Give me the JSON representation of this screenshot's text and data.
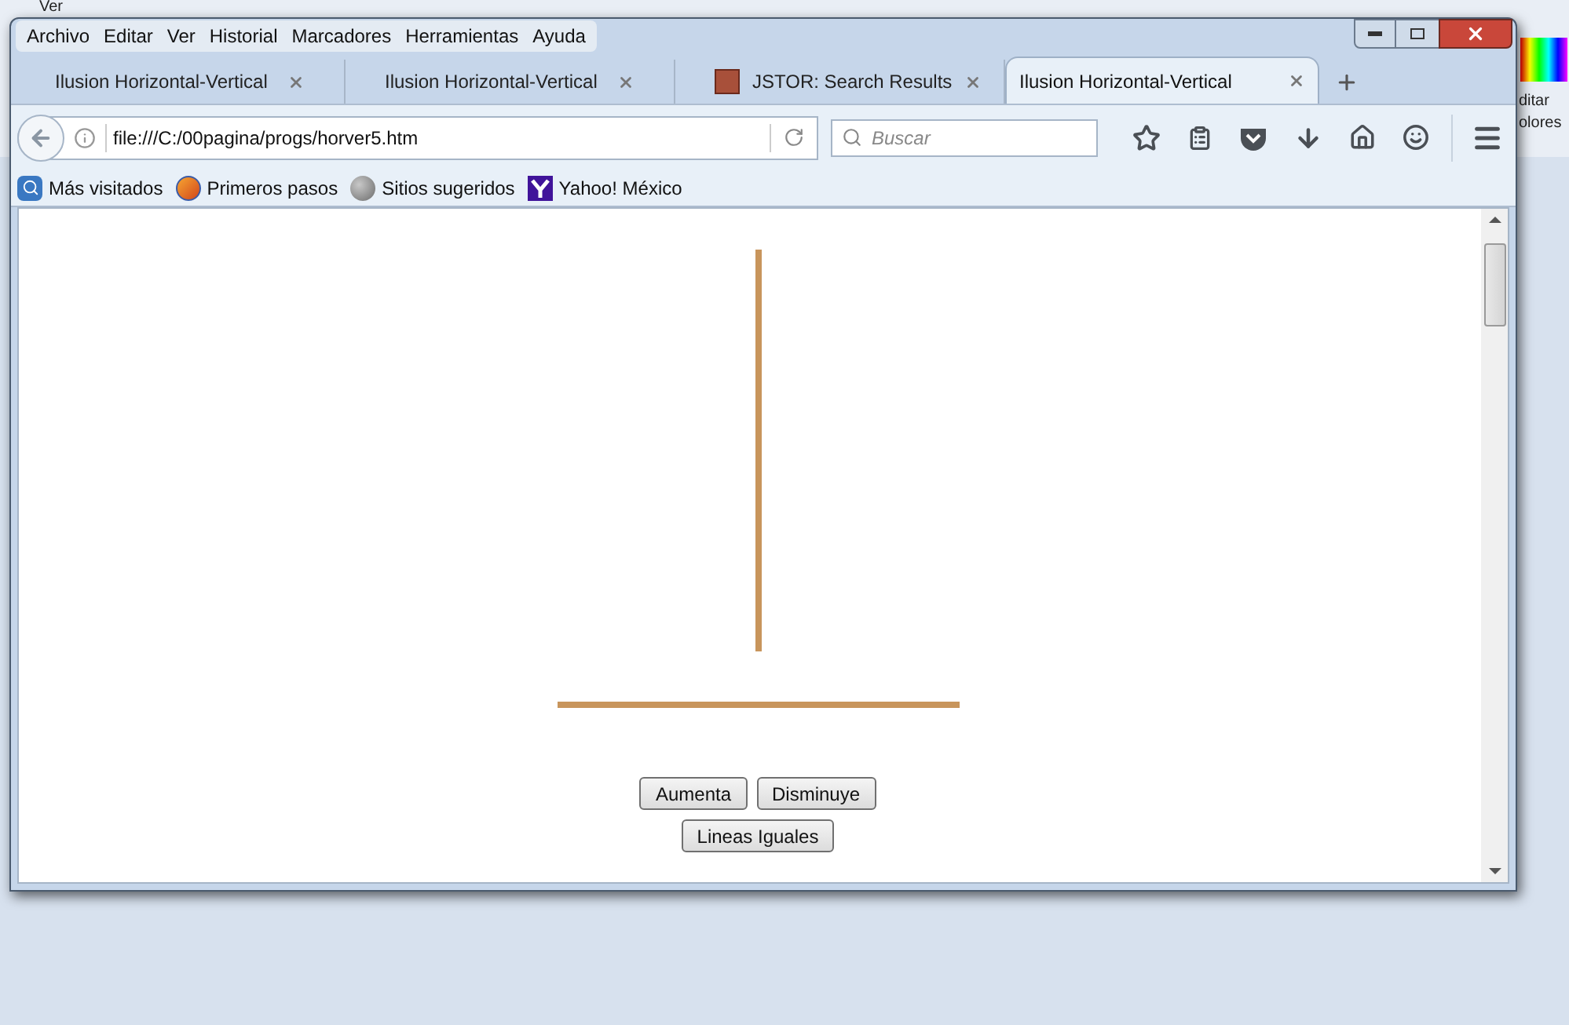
{
  "background_app": {
    "menu_label": "Ver",
    "side_labels": [
      "ditar",
      "olores"
    ]
  },
  "menubar": [
    "Archivo",
    "Editar",
    "Ver",
    "Historial",
    "Marcadores",
    "Herramientas",
    "Ayuda"
  ],
  "tabs": [
    {
      "title": "Ilusion Horizontal-Vertical",
      "selected": false,
      "kind": "plain"
    },
    {
      "title": "Ilusion Horizontal-Vertical",
      "selected": false,
      "kind": "plain"
    },
    {
      "title": "JSTOR: Search Results",
      "selected": false,
      "kind": "jstor"
    },
    {
      "title": "Ilusion Horizontal-Vertical",
      "selected": true,
      "kind": "plain"
    }
  ],
  "address_bar": {
    "value": "file:///C:/00pagina/progs/horver5.htm"
  },
  "search": {
    "placeholder": "Buscar"
  },
  "bookmarks": [
    {
      "label": "Más visitados",
      "kind": "magnifier"
    },
    {
      "label": "Primeros pasos",
      "kind": "firefox"
    },
    {
      "label": "Sitios sugeridos",
      "kind": "globe"
    },
    {
      "label": "Yahoo! México",
      "kind": "yahoo"
    }
  ],
  "page": {
    "buttons": [
      "Aumenta",
      "Disminuye"
    ],
    "reset_button": "Lineas Iguales"
  }
}
